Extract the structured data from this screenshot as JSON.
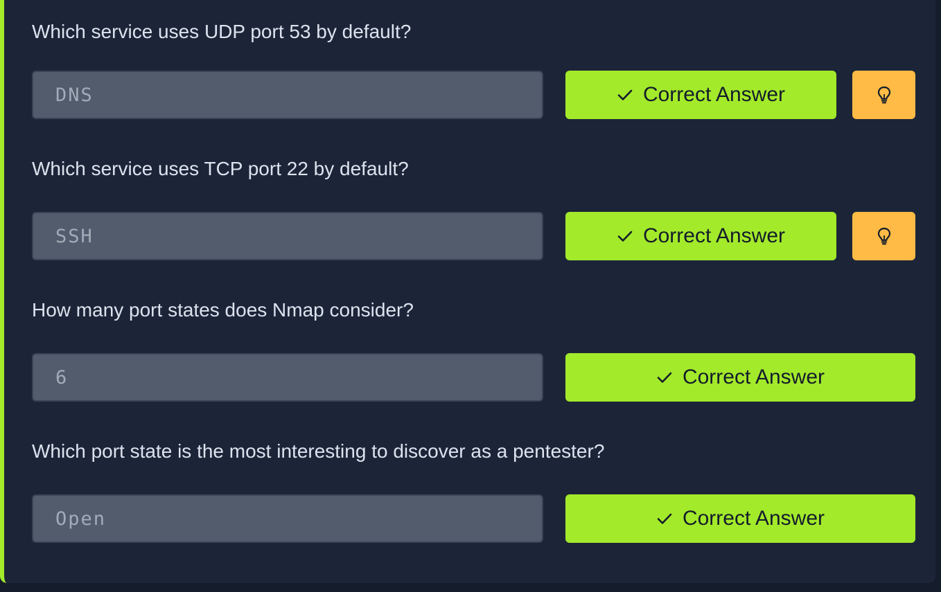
{
  "questions": [
    {
      "text": "Which service uses UDP port 53 by default?",
      "answer": "DNS",
      "button_label": "Correct Answer",
      "has_hint": true
    },
    {
      "text": "Which service uses TCP port 22 by default?",
      "answer": "SSH",
      "button_label": "Correct Answer",
      "has_hint": true
    },
    {
      "text": "How many port states does Nmap consider?",
      "answer": "6",
      "button_label": "Correct Answer",
      "has_hint": false
    },
    {
      "text": "Which port state is the most interesting to discover as a pentester?",
      "answer": "Open",
      "button_label": "Correct Answer",
      "has_hint": false
    }
  ],
  "icons": {
    "correct": "check-icon",
    "hint": "lightbulb-icon"
  },
  "colors": {
    "background": "#1c2538",
    "accent": "#a3ea2a",
    "hint": "#ffbb45",
    "input_bg": "#525c6c",
    "question_text": "#dde3ee"
  }
}
